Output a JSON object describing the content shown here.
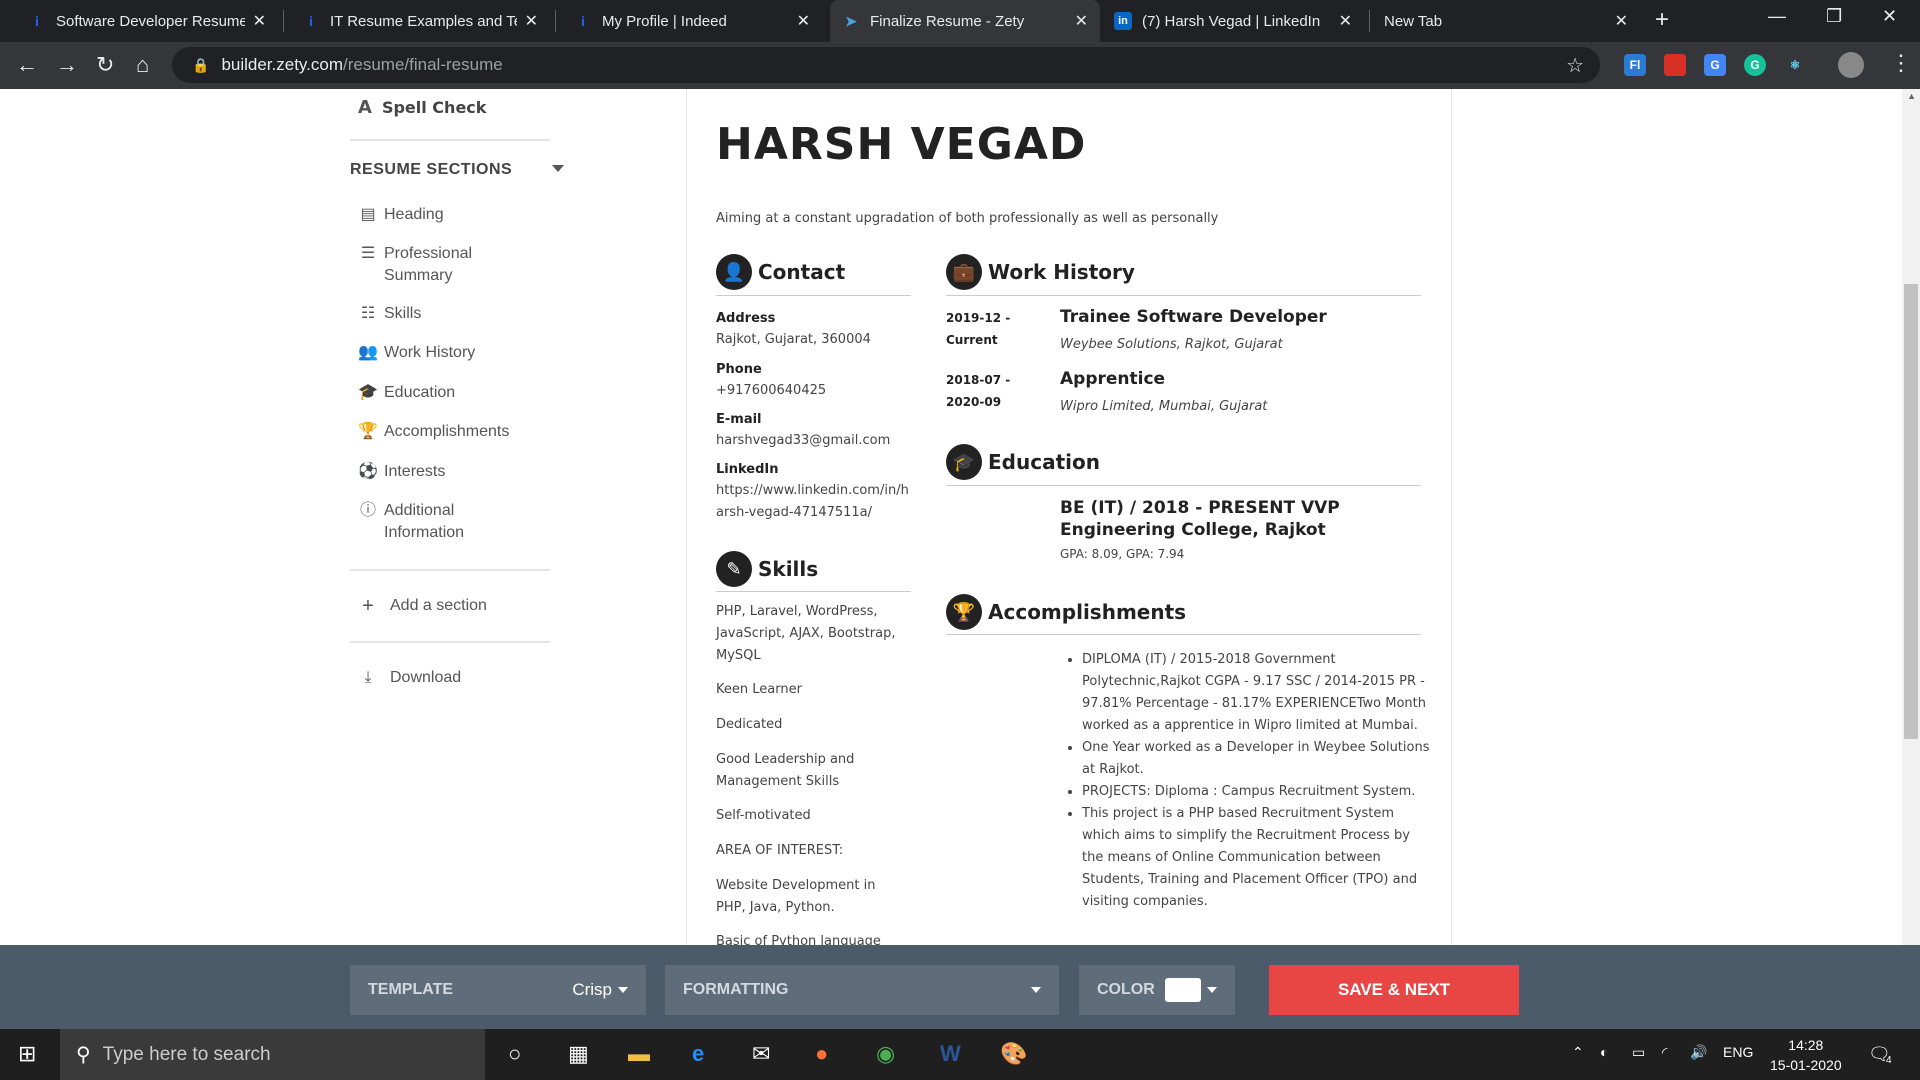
{
  "browser": {
    "tabs": [
      {
        "title": "Software Developer Resume E",
        "favicon": "indeed-i"
      },
      {
        "title": "IT Resume Examples and Tem",
        "favicon": "indeed-i"
      },
      {
        "title": "My Profile | Indeed",
        "favicon": "indeed-i"
      },
      {
        "title": "Finalize Resume - Zety",
        "favicon": "zety"
      },
      {
        "title": "(7) Harsh Vegad | LinkedIn",
        "favicon": "in"
      },
      {
        "title": "New Tab",
        "favicon": ""
      }
    ],
    "url_host": "builder.zety.com",
    "url_path": "/resume/final-resume"
  },
  "sidebar": {
    "spell_check": "Spell Check",
    "sections_title": "RESUME SECTIONS",
    "items": [
      {
        "label": "Heading",
        "icon": "document-icon"
      },
      {
        "label": "Professional Summary",
        "icon": "list-lines-icon"
      },
      {
        "label": "Skills",
        "icon": "list-bullets-icon"
      },
      {
        "label": "Work History",
        "icon": "users-icon"
      },
      {
        "label": "Education",
        "icon": "graduation-cap-icon"
      },
      {
        "label": "Accomplishments",
        "icon": "trophy-icon"
      },
      {
        "label": "Interests",
        "icon": "basketball-icon"
      },
      {
        "label": "Additional Information",
        "icon": "info-icon"
      }
    ],
    "add_section": "Add a section",
    "download": "Download"
  },
  "resume": {
    "name": "HARSH VEGAD",
    "summary": "Aiming at a constant upgradation of both professionally as well as personally",
    "contact": {
      "title": "Contact",
      "address_label": "Address",
      "address": "Rajkot, Gujarat, 360004",
      "phone_label": "Phone",
      "phone": "+917600640425",
      "email_label": "E-mail",
      "email": "harshvegad33@gmail.com",
      "linkedin_label": "LinkedIn",
      "linkedin": "https://www.linkedin.com/in/harsh-vegad-47147511a/"
    },
    "skills": {
      "title": "Skills",
      "items": [
        "PHP, Laravel, WordPress, JavaScript, AJAX, Bootstrap, MySQL",
        "Keen Learner",
        "Dedicated",
        "Good Leadership and Management Skills",
        "Self-motivated",
        "AREA OF INTEREST:",
        "Website Development in PHP, Java, Python.",
        "Basic of Python language"
      ]
    },
    "work": {
      "title": "Work History",
      "jobs": [
        {
          "date1": "2019-12 -",
          "date2": "Current",
          "title": "Trainee Software Developer",
          "company": "Weybee Solutions, Rajkot, Gujarat"
        },
        {
          "date1": "2018-07 -",
          "date2": "2020-09",
          "title": "Apprentice",
          "company": "Wipro Limited, Mumbai, Gujarat"
        }
      ]
    },
    "education": {
      "title": "Education",
      "degree": "BE (IT) / 2018 - PRESENT VVP Engineering College, Rajkot",
      "gpa": "GPA: 8.09, GPA: 7.94"
    },
    "accomplishments": {
      "title": "Accomplishments",
      "items": [
        "DIPLOMA (IT) / 2015-2018 Government Polytechnic,Rajkot CGPA - 9.17 SSC / 2014-2015 PR - 97.81% Percentage - 81.17% EXPERIENCETwo Month worked as a apprentice in Wipro limited at Mumbai.",
        "One Year worked as a Developer in Weybee Solutions at Rajkot.",
        "PROJECTS: Diploma : Campus Recruitment System.",
        "This project is a PHP based Recruitment System which aims to simplify the Recruitment Process by the means of Online Communication between Students, Training and Placement Officer (TPO) and visiting companies."
      ]
    }
  },
  "builder_bar": {
    "template_label": "TEMPLATE",
    "template_value": "Crisp",
    "formatting_label": "FORMATTING",
    "color_label": "COLOR",
    "save_label": "SAVE & NEXT"
  },
  "taskbar": {
    "search_placeholder": "Type here to search",
    "lang": "ENG",
    "time": "14:28",
    "date": "15-01-2020",
    "notifications": "4"
  }
}
